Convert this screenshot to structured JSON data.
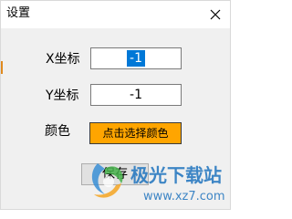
{
  "window": {
    "title": "设置"
  },
  "icons": {
    "close": "close-icon"
  },
  "form": {
    "x_label": "X坐标",
    "x_value": "-1",
    "y_label": "Y坐标",
    "y_value": "-1",
    "color_label": "颜色",
    "color_button_label": "点击选择颜色",
    "color_button_bg": "#ffa500"
  },
  "buttons": {
    "save_label": "保存"
  },
  "watermark": {
    "brand": "极光下载站",
    "url": "www.xz7.com"
  }
}
